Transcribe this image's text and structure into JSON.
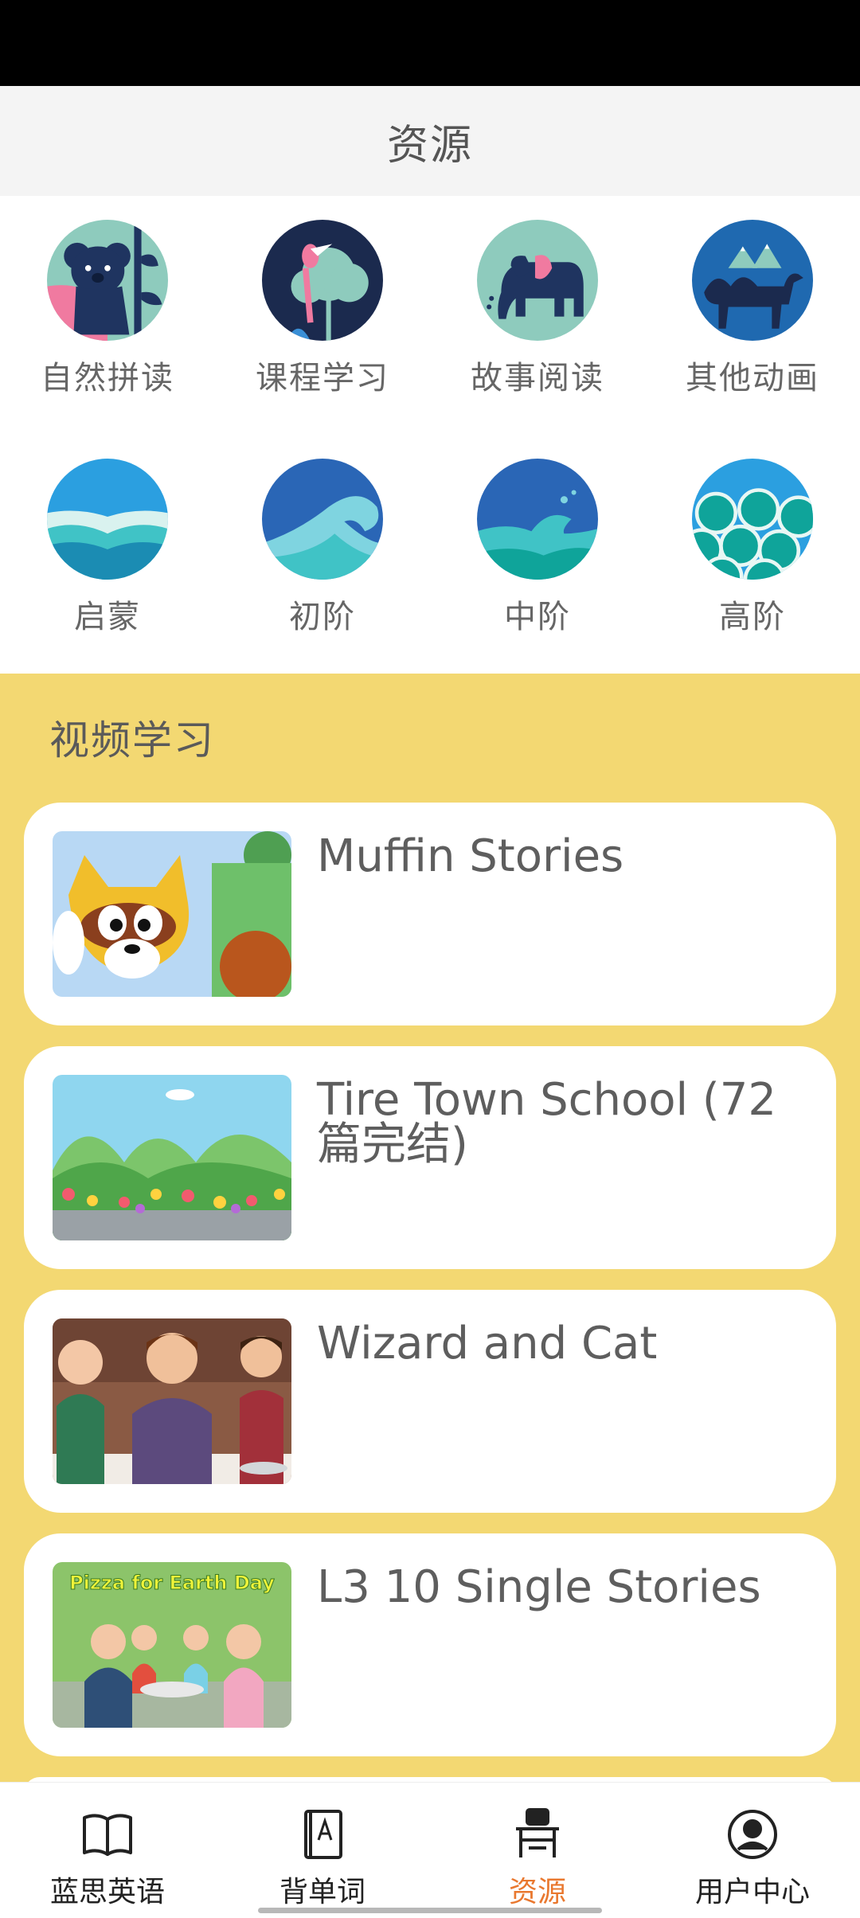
{
  "header": {
    "title": "资源"
  },
  "categories": [
    {
      "label": "自然拼读",
      "icon": "koala-icon"
    },
    {
      "label": "课程学习",
      "icon": "toucan-icon"
    },
    {
      "label": "故事阅读",
      "icon": "elephant-icon"
    },
    {
      "label": "其他动画",
      "icon": "camel-icon"
    },
    {
      "label": "启蒙",
      "icon": "wave-calm-icon"
    },
    {
      "label": "初阶",
      "icon": "wave-curl-icon"
    },
    {
      "label": "中阶",
      "icon": "wave-splash-icon"
    },
    {
      "label": "高阶",
      "icon": "wave-swirl-icon"
    }
  ],
  "videos": {
    "section_title": "视频学习",
    "items": [
      {
        "title": "Muffin Stories"
      },
      {
        "title": "Tire Town School (72篇完结)"
      },
      {
        "title": "Wizard and Cat"
      },
      {
        "title": "L3 10 Single Stories",
        "thumb_caption": "Pizza for Earth Day"
      }
    ]
  },
  "tabbar": {
    "items": [
      {
        "label": "蓝思英语",
        "icon": "book-open-icon"
      },
      {
        "label": "背单词",
        "icon": "dictionary-icon"
      },
      {
        "label": "资源",
        "icon": "desk-icon",
        "active": true
      },
      {
        "label": "用户中心",
        "icon": "user-circle-icon"
      }
    ]
  },
  "colors": {
    "accent": "#e9782f",
    "section_bg": "#f3d872"
  }
}
